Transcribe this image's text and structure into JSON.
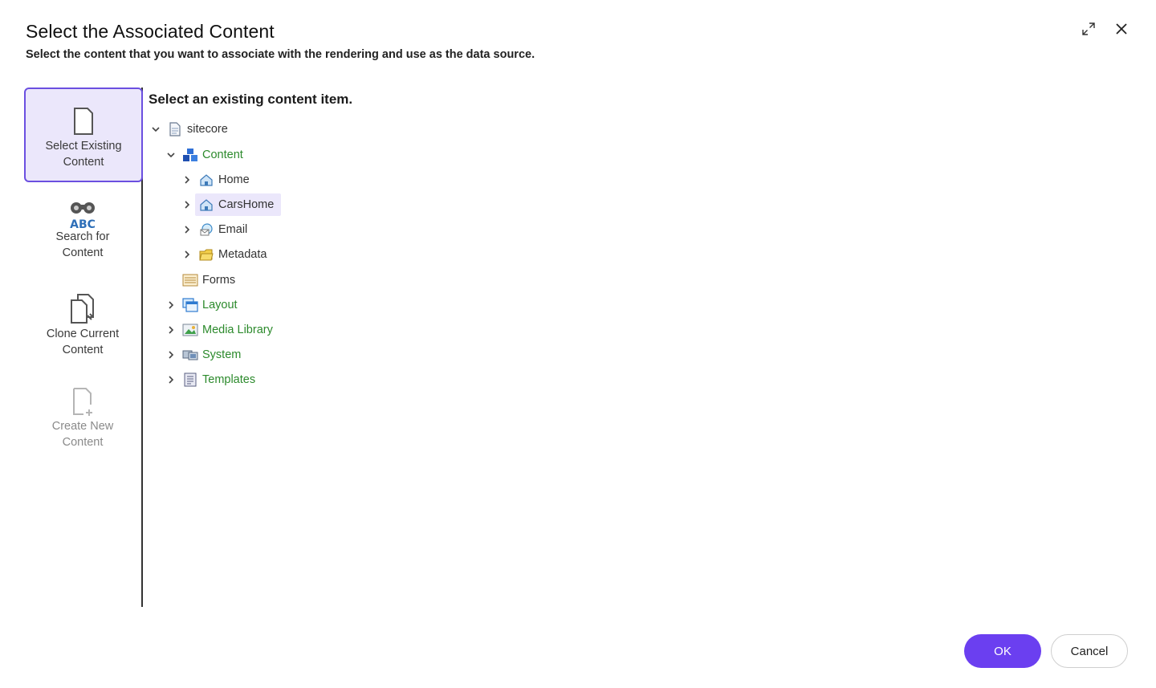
{
  "dialog": {
    "title": "Select the Associated Content",
    "subtitle": "Select the content that you want to associate with the rendering and use as the data source.",
    "maximize_icon": "expand-icon",
    "close_icon": "close-icon"
  },
  "nav": {
    "items": [
      {
        "label_line1": "Select Existing",
        "label_line2": "Content",
        "icon": "document-icon",
        "state": "active"
      },
      {
        "label_line1": "Search for",
        "label_line2": "Content",
        "icon": "binoculars-abc-icon",
        "state": "normal"
      },
      {
        "label_line1": "Clone Current",
        "label_line2": "Content",
        "icon": "clone-document-icon",
        "state": "normal"
      },
      {
        "label_line1": "Create New",
        "label_line2": "Content",
        "icon": "new-document-icon",
        "state": "disabled"
      }
    ]
  },
  "main": {
    "heading": "Select an existing content item.",
    "tree": [
      {
        "label": "sitecore",
        "icon": "sitecore-page-icon",
        "expanded": true,
        "has_children": true
      },
      {
        "label": "Content",
        "icon": "content-cubes-icon",
        "expanded": true,
        "has_children": true
      },
      {
        "label": "Home",
        "icon": "home-icon",
        "expanded": false,
        "has_children": true
      },
      {
        "label": "CarsHome",
        "icon": "home-icon",
        "expanded": false,
        "has_children": true,
        "selected": true
      },
      {
        "label": "Email",
        "icon": "email-icon",
        "expanded": false,
        "has_children": true
      },
      {
        "label": "Metadata",
        "icon": "folder-icon",
        "expanded": false,
        "has_children": true
      },
      {
        "label": "Forms",
        "icon": "forms-icon",
        "expanded": false,
        "has_children": false
      },
      {
        "label": "Layout",
        "icon": "layout-icon",
        "expanded": false,
        "has_children": true
      },
      {
        "label": "Media Library",
        "icon": "media-library-icon",
        "expanded": false,
        "has_children": true
      },
      {
        "label": "System",
        "icon": "system-icon",
        "expanded": false,
        "has_children": true
      },
      {
        "label": "Templates",
        "icon": "templates-icon",
        "expanded": false,
        "has_children": true
      }
    ]
  },
  "footer": {
    "ok_label": "OK",
    "cancel_label": "Cancel"
  },
  "colors": {
    "accent": "#6b3ff0",
    "selection": "#ebe7fb",
    "tree_green": "#2c8a2c"
  }
}
